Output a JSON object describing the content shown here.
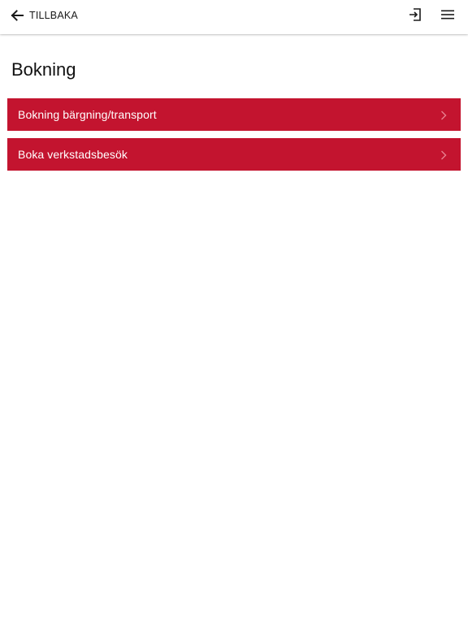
{
  "header": {
    "back_label": "TILLBAKA",
    "back_icon": "arrow-left-icon",
    "login_icon": "login-icon",
    "menu_icon": "hamburger-menu-icon"
  },
  "page": {
    "title": "Bokning"
  },
  "list": {
    "items": [
      {
        "label": "Bokning bärgning/transport",
        "icon": "chevron-right-icon"
      },
      {
        "label": "Boka verkstadsbesök",
        "icon": "chevron-right-icon"
      }
    ]
  },
  "colors": {
    "accent": "#c3142f",
    "background": "#ffffff",
    "text": "#111111"
  }
}
